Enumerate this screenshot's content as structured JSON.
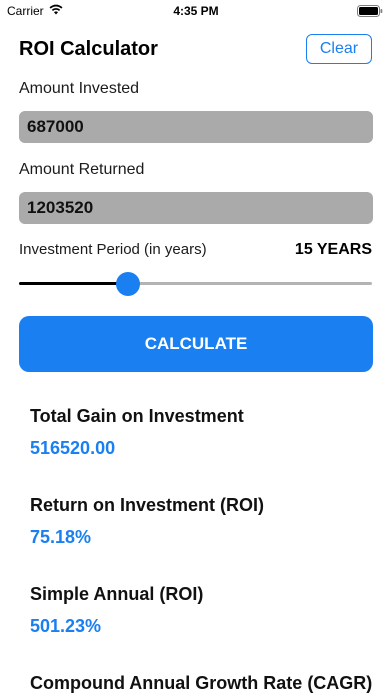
{
  "status_bar": {
    "carrier": "Carrier",
    "time": "4:35 PM",
    "icons": [
      "wifi-icon",
      "battery-icon"
    ]
  },
  "header": {
    "title": "ROI Calculator",
    "clear_label": "Clear"
  },
  "form": {
    "amount_invested_label": "Amount Invested",
    "amount_invested_value": "687000",
    "amount_returned_label": "Amount Returned",
    "amount_returned_value": "1203520",
    "period_label": "Investment Period (in years)",
    "period_value": "15 YEARS",
    "period_slider_fraction": 0.31,
    "calculate_label": "CALCULATE"
  },
  "results": [
    {
      "label": "Total Gain on Investment",
      "value": "516520.00"
    },
    {
      "label": "Return on Investment (ROI)",
      "value": "75.18%"
    },
    {
      "label": "Simple Annual (ROI)",
      "value": "501.23%"
    },
    {
      "label": "Compound Annual Growth Rate (CAGR)",
      "value": ""
    }
  ],
  "colors": {
    "accent": "#1a7ff0",
    "input_bg": "#aaaaaa",
    "slider_fill": "#000000",
    "slider_track": "#b3b3b3"
  }
}
